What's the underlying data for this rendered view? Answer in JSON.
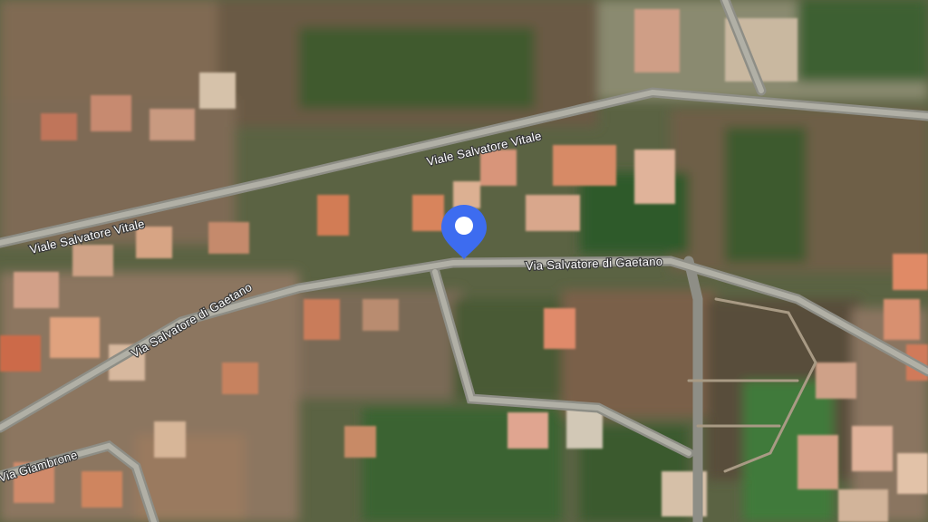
{
  "map": {
    "view": "satellite",
    "roads": [
      {
        "id": "viale-salvatore-vitale-east",
        "label": "Viale Salvatore Vitale"
      },
      {
        "id": "viale-salvatore-vitale-west",
        "label": "Viale Salvatore Vitale"
      },
      {
        "id": "via-salvatore-di-gaetano-east",
        "label": "Via Salvatore di Gaetano"
      },
      {
        "id": "via-salvatore-di-gaetano-west",
        "label": "Via Salvatore di Gaetano"
      },
      {
        "id": "via-giambrone",
        "label": "Via Giambrone"
      }
    ],
    "marker": {
      "color": "#3d6cf0",
      "icon": "map-pin-icon"
    }
  }
}
